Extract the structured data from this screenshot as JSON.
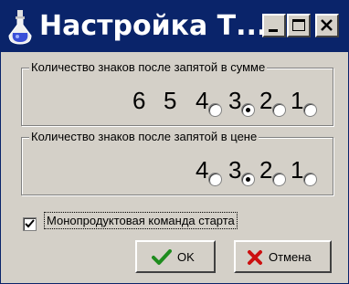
{
  "window": {
    "title": "Настройка Т...",
    "controls": [
      "minimize",
      "maximize",
      "close"
    ]
  },
  "sum_group": {
    "legend": "Количество знаков после запятой в сумме",
    "options": [
      {
        "label": "6",
        "has_radio": false,
        "selected": false
      },
      {
        "label": "5",
        "has_radio": false,
        "selected": false
      },
      {
        "label": "4",
        "has_radio": true,
        "selected": false
      },
      {
        "label": "3",
        "has_radio": true,
        "selected": true
      },
      {
        "label": "2",
        "has_radio": true,
        "selected": false
      },
      {
        "label": "1",
        "has_radio": true,
        "selected": false
      }
    ]
  },
  "price_group": {
    "legend": "Количество знаков после запятой в цене",
    "options": [
      {
        "label": "4",
        "selected": false
      },
      {
        "label": "3",
        "selected": true
      },
      {
        "label": "2",
        "selected": false
      },
      {
        "label": "1",
        "selected": false
      }
    ]
  },
  "checkbox": {
    "label": "Монопродуктовая команда старта",
    "checked": true
  },
  "buttons": {
    "ok_label": "OK",
    "cancel_label": "Отмена"
  },
  "colors": {
    "titlebar": "#0a246a",
    "face": "#d4d0c8",
    "ok_check": "#1e8c1e",
    "cancel_x": "#cc1010"
  },
  "icons": {
    "app": "flask-icon",
    "ok": "check-icon",
    "cancel": "x-icon"
  }
}
